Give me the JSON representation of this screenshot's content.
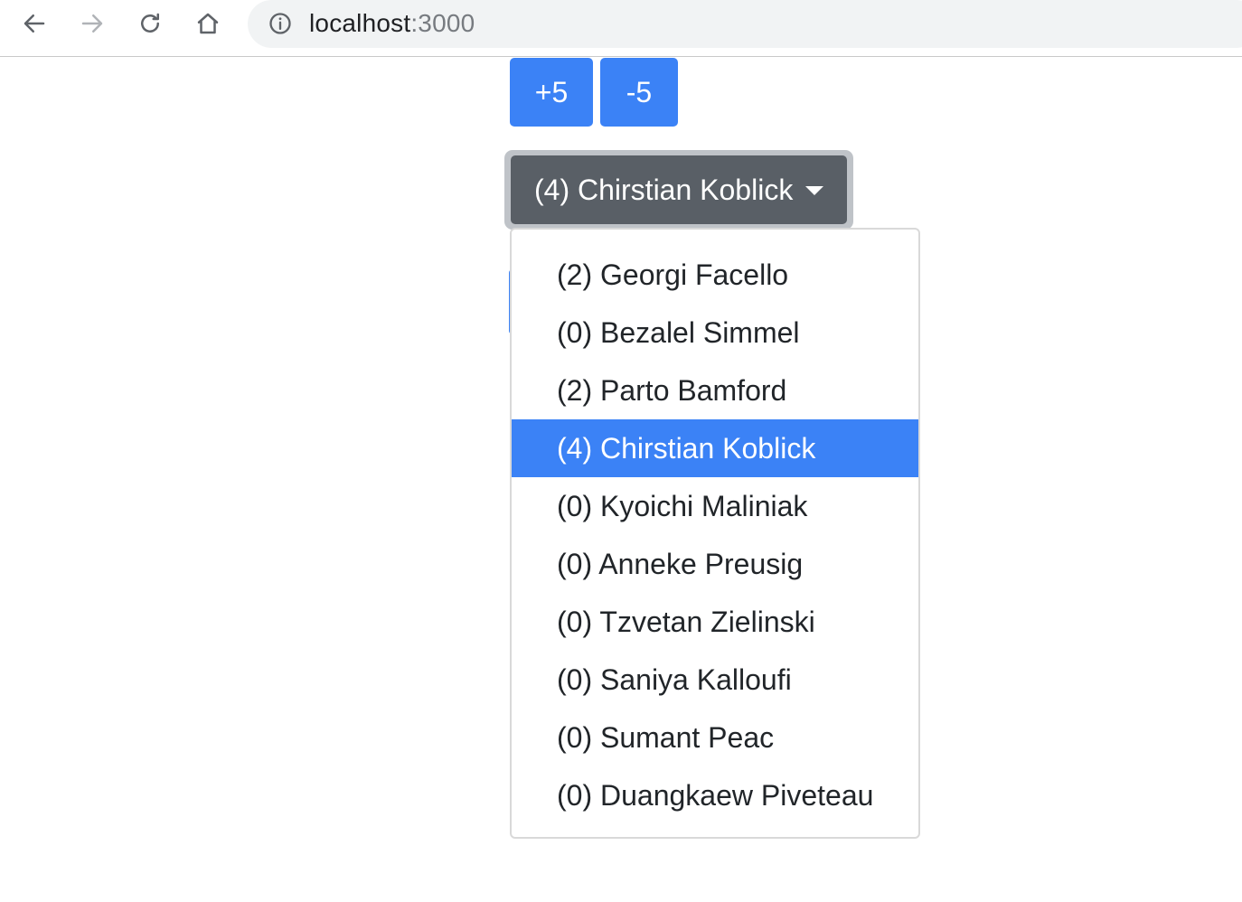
{
  "browser": {
    "url_host": "localhost",
    "url_port": ":3000",
    "icons": [
      "back-arrow-icon",
      "forward-arrow-icon",
      "reload-icon",
      "home-icon",
      "info-icon"
    ]
  },
  "controls": {
    "plus_label": "+5",
    "minus_label": "-5"
  },
  "dropdown": {
    "selected_label": "(4) Chirstian Koblick",
    "items": [
      {
        "label": "(2) Georgi Facello"
      },
      {
        "label": "(0) Bezalel Simmel"
      },
      {
        "label": "(2) Parto Bamford"
      },
      {
        "label": "(4) Chirstian Koblick",
        "active": true
      },
      {
        "label": "(0) Kyoichi Maliniak"
      },
      {
        "label": "(0) Anneke Preusig"
      },
      {
        "label": "(0) Tzvetan Zielinski"
      },
      {
        "label": "(0) Saniya Kalloufi"
      },
      {
        "label": "(0) Sumant Peac"
      },
      {
        "label": "(0) Duangkaew Piveteau"
      }
    ]
  },
  "colors": {
    "primary": "#3b82f6",
    "secondary": "#595f66",
    "focus_ring": "#bfc3c8",
    "menu_border": "#d9d9d9",
    "text": "#212529"
  }
}
